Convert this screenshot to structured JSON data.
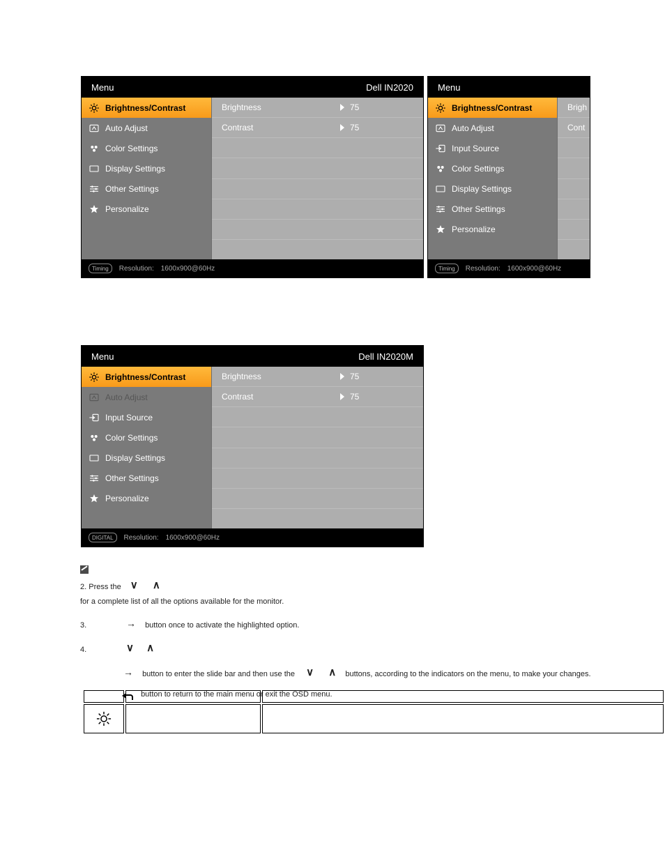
{
  "osd": [
    {
      "id": "osd1",
      "menuLabel": "Menu",
      "model": "Dell IN2020",
      "items": [
        {
          "icon": "sun",
          "label": "Brightness/Contrast",
          "highlight": true
        },
        {
          "icon": "auto",
          "label": "Auto Adjust"
        },
        {
          "icon": "dots",
          "label": "Color Settings"
        },
        {
          "icon": "display",
          "label": "Display Settings"
        },
        {
          "icon": "sliders",
          "label": "Other Settings"
        },
        {
          "icon": "star",
          "label": "Personalize"
        }
      ],
      "rightRows": [
        {
          "label": "Brightness",
          "value": "75"
        },
        {
          "label": "Contrast",
          "value": "75"
        },
        {},
        {},
        {},
        {},
        {},
        {}
      ],
      "footerBadge": "Timing",
      "resolutionLabel": "Resolution:",
      "resolutionValue": "1600x900@60Hz"
    },
    {
      "id": "osd2",
      "cropped": true,
      "menuLabel": "Menu",
      "model": "",
      "items": [
        {
          "icon": "sun",
          "label": "Brightness/Contrast",
          "highlight": true
        },
        {
          "icon": "auto",
          "label": "Auto Adjust"
        },
        {
          "icon": "input",
          "label": "Input Source"
        },
        {
          "icon": "dots",
          "label": "Color Settings"
        },
        {
          "icon": "display",
          "label": "Display Settings"
        },
        {
          "icon": "sliders",
          "label": "Other Settings"
        },
        {
          "icon": "star",
          "label": "Personalize"
        }
      ],
      "rightRows": [
        {
          "label": "Brigh"
        },
        {
          "label": "Cont"
        },
        {},
        {},
        {},
        {},
        {},
        {}
      ],
      "footerBadge": "Timing",
      "resolutionLabel": "Resolution:",
      "resolutionValue": "1600x900@60Hz"
    },
    {
      "id": "osd3",
      "menuLabel": "Menu",
      "model": "Dell IN2020M",
      "items": [
        {
          "icon": "sun",
          "label": "Brightness/Contrast",
          "highlight": true
        },
        {
          "icon": "auto",
          "label": "Auto Adjust",
          "disabled": true
        },
        {
          "icon": "input",
          "label": "Input Source"
        },
        {
          "icon": "dots",
          "label": "Color Settings"
        },
        {
          "icon": "display",
          "label": "Display Settings"
        },
        {
          "icon": "sliders",
          "label": "Other Settings"
        },
        {
          "icon": "star",
          "label": "Personalize"
        }
      ],
      "rightRows": [
        {
          "label": "Brightness",
          "value": "75"
        },
        {
          "label": "Contrast",
          "value": "75"
        },
        {},
        {},
        {},
        {},
        {},
        {}
      ],
      "footerBadge": "DIGITAL",
      "resolutionLabel": "Resolution:",
      "resolutionValue": "1600x900@60Hz"
    }
  ],
  "instructions": {
    "step2_prefix": "2. Press the",
    "step2_line2": "for a complete list of all the options available for the monitor.",
    "step3_num": "3.",
    "step3_text": "button once to activate the highlighted option.",
    "step4_num": "4.",
    "step5_text1": "button to enter the slide bar and then use the",
    "step5_text2": "buttons, according to the indicators on the menu, to make your changes.",
    "step6_text": "button to return to the main menu or exit the OSD menu."
  }
}
